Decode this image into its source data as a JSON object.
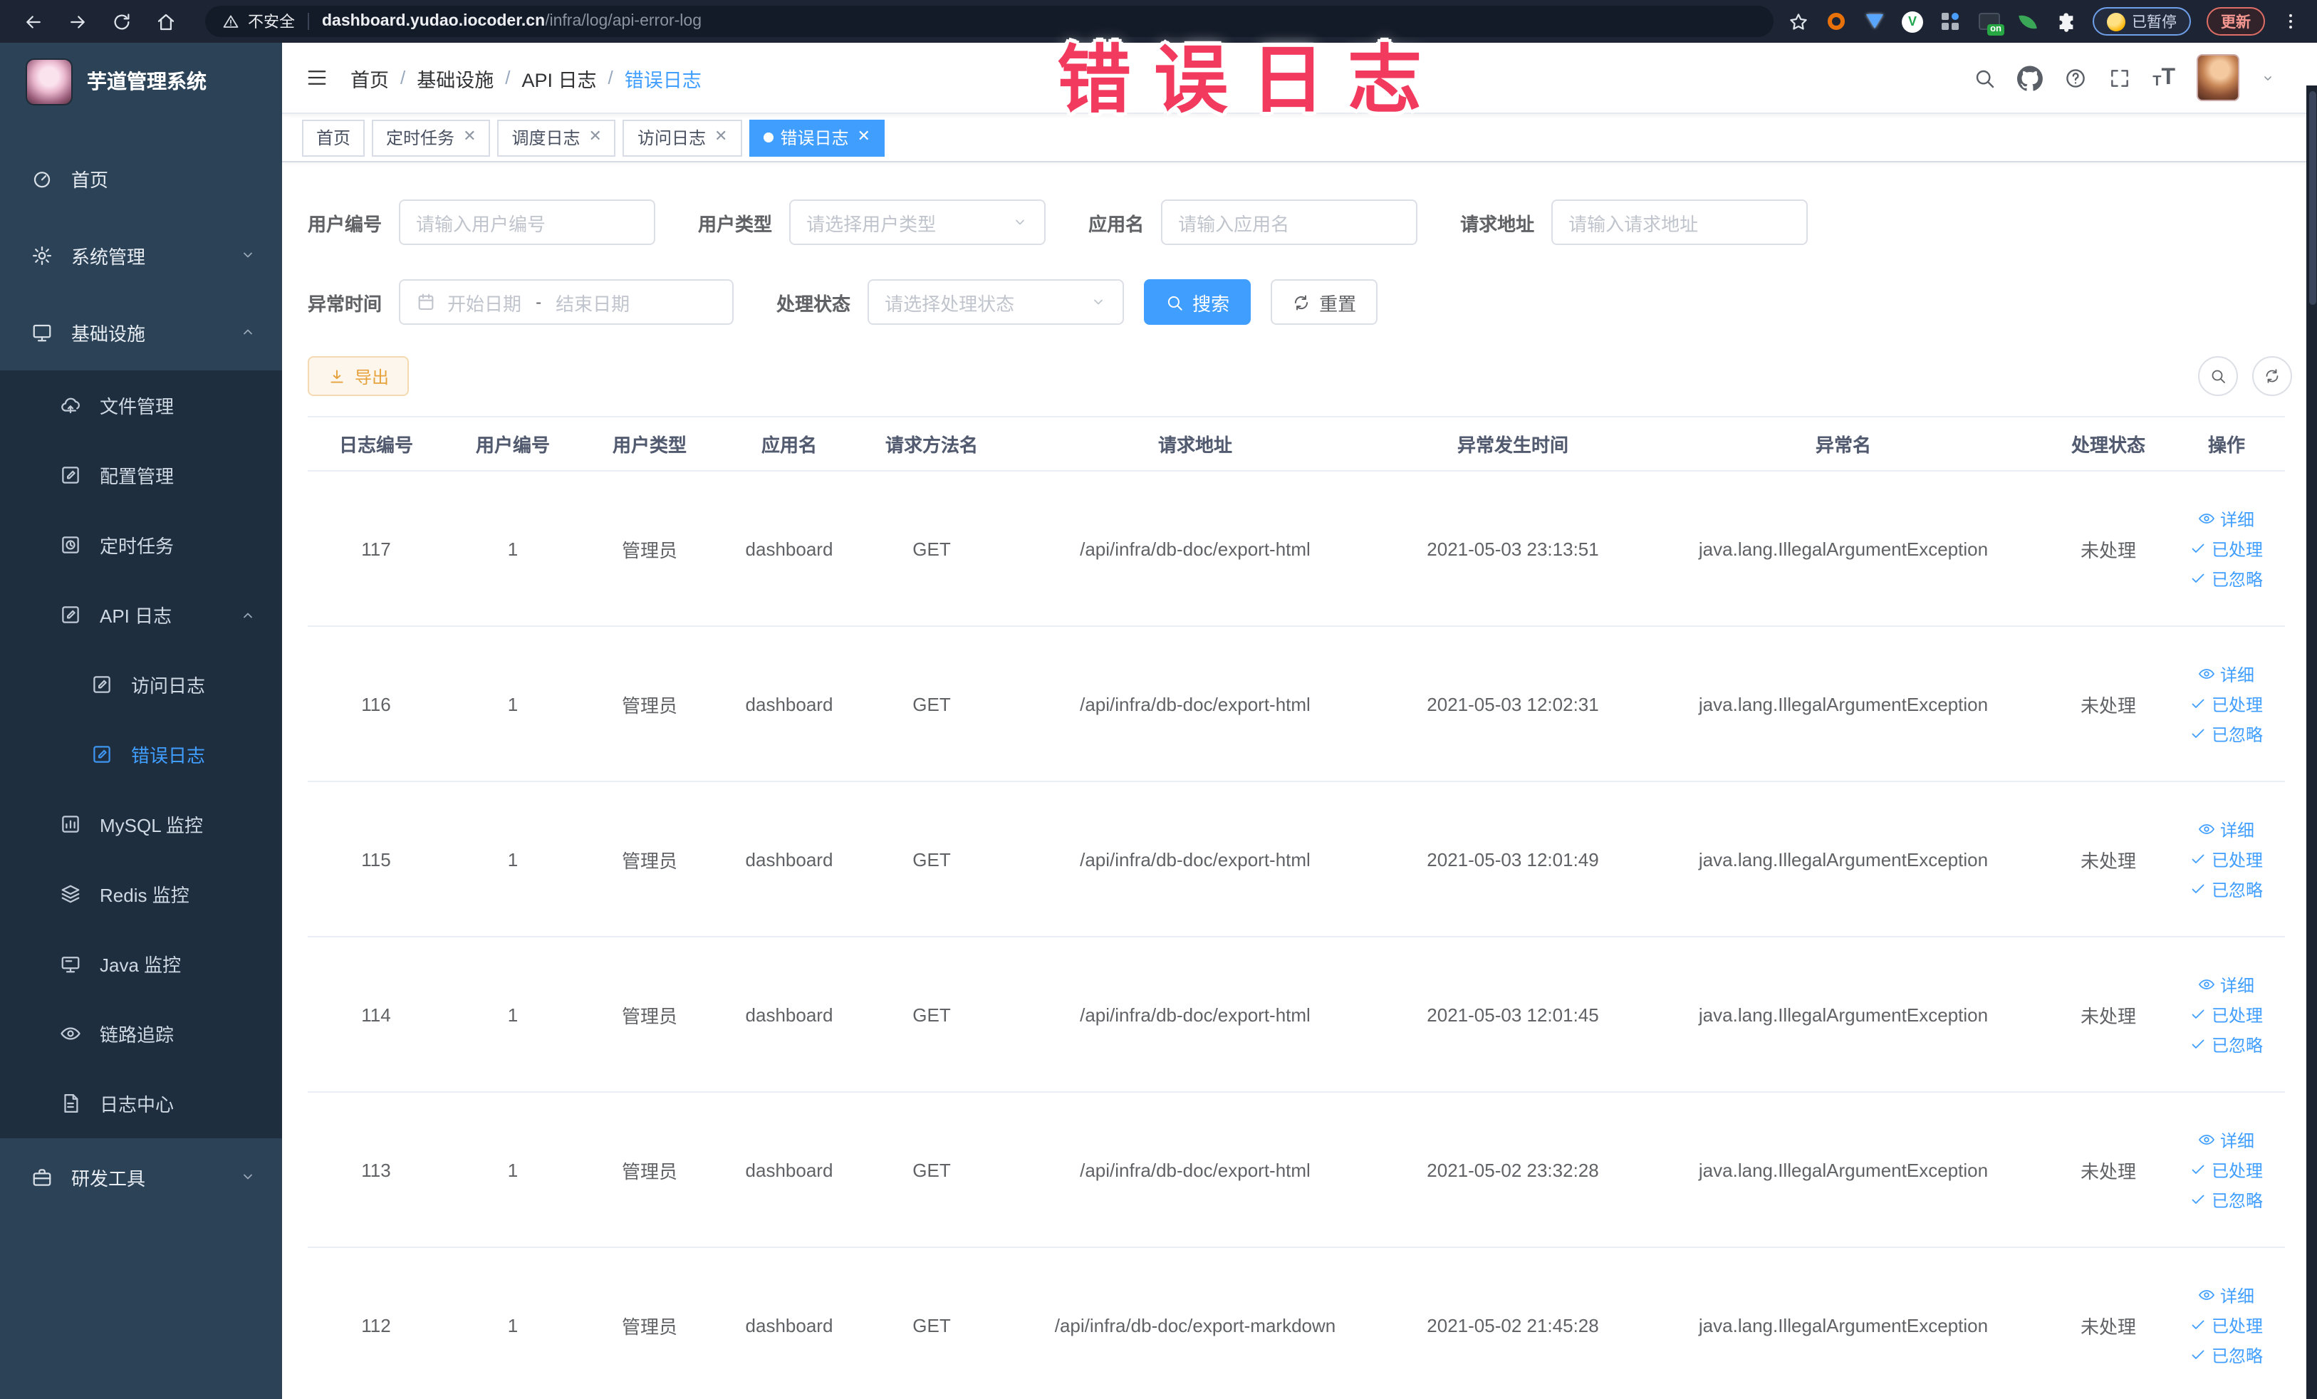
{
  "colors": {
    "accent": "#409eff",
    "warning": "#e6a23c",
    "watermark_red": "#f23a5e",
    "sidebar_bg": "#2c4257",
    "sidebar_section_bg": "#1f2e3f"
  },
  "watermark": {
    "text": "错误日志"
  },
  "browser": {
    "security_label": "不安全",
    "url_host": "dashboard.yudao.iocoder.cn",
    "url_path": "/infra/log/api-error-log",
    "ext_on": "on",
    "paused_label": "已暂停",
    "update_label": "更新"
  },
  "sidebar": {
    "title": "芋道管理系统",
    "items": [
      {
        "key": "home",
        "label": "首页",
        "icon": "dashboard-icon",
        "level": 1
      },
      {
        "key": "system",
        "label": "系统管理",
        "icon": "gear-icon",
        "level": 1,
        "arrow": "down"
      },
      {
        "key": "infra",
        "label": "基础设施",
        "icon": "monitor-icon",
        "level": 1,
        "arrow": "up"
      },
      {
        "key": "file",
        "label": "文件管理",
        "icon": "upload-cloud-icon",
        "level": 2,
        "section": true
      },
      {
        "key": "config",
        "label": "配置管理",
        "icon": "edit-icon",
        "level": 2,
        "section": true
      },
      {
        "key": "job",
        "label": "定时任务",
        "icon": "clock-square-icon",
        "level": 2,
        "section": true
      },
      {
        "key": "api-log",
        "label": "API 日志",
        "icon": "edit-icon",
        "level": 2,
        "arrow": "up",
        "section": true
      },
      {
        "key": "access-log",
        "label": "访问日志",
        "icon": "edit-icon",
        "level": 3,
        "section": true
      },
      {
        "key": "error-log",
        "label": "错误日志",
        "icon": "edit-icon",
        "level": 3,
        "section": true,
        "active": true
      },
      {
        "key": "mysql",
        "label": "MySQL 监控",
        "icon": "chart-icon",
        "level": 2,
        "section": true
      },
      {
        "key": "redis",
        "label": "Redis 监控",
        "icon": "layers-icon",
        "level": 2,
        "section": true
      },
      {
        "key": "java",
        "label": "Java 监控",
        "icon": "screen-icon",
        "level": 2,
        "section": true
      },
      {
        "key": "trace",
        "label": "链路追踪",
        "icon": "eye-icon",
        "level": 2,
        "section": true
      },
      {
        "key": "log-center",
        "label": "日志中心",
        "icon": "doc-icon",
        "level": 2,
        "section": true
      },
      {
        "key": "dev-tools",
        "label": "研发工具",
        "icon": "briefcase-icon",
        "level": 1,
        "arrow": "down"
      }
    ]
  },
  "breadcrumb": [
    "首页",
    "基础设施",
    "API 日志",
    "错误日志"
  ],
  "tabs": [
    {
      "label": "首页",
      "closable": false,
      "active": false
    },
    {
      "label": "定时任务",
      "closable": true,
      "active": false
    },
    {
      "label": "调度日志",
      "closable": true,
      "active": false
    },
    {
      "label": "访问日志",
      "closable": true,
      "active": false
    },
    {
      "label": "错误日志",
      "closable": true,
      "active": true
    }
  ],
  "filters": {
    "user_id": {
      "label": "用户编号",
      "placeholder": "请输入用户编号"
    },
    "user_type": {
      "label": "用户类型",
      "placeholder": "请选择用户类型"
    },
    "app_name": {
      "label": "应用名",
      "placeholder": "请输入应用名"
    },
    "request_url": {
      "label": "请求地址",
      "placeholder": "请输入请求地址"
    },
    "exception_time": {
      "label": "异常时间",
      "start_placeholder": "开始日期",
      "separator": "-",
      "end_placeholder": "结束日期"
    },
    "process_status": {
      "label": "处理状态",
      "placeholder": "请选择处理状态"
    },
    "search_label": "搜索",
    "reset_label": "重置"
  },
  "toolbar": {
    "export_label": "导出"
  },
  "table": {
    "columns": [
      "日志编号",
      "用户编号",
      "用户类型",
      "应用名",
      "请求方法名",
      "请求地址",
      "异常发生时间",
      "异常名",
      "处理状态",
      "操作"
    ],
    "row_actions": [
      {
        "icon": "eye-icon",
        "label": "详细"
      },
      {
        "icon": "check-icon",
        "label": "已处理"
      },
      {
        "icon": "check-icon",
        "label": "已忽略"
      }
    ],
    "rows": [
      {
        "id": "117",
        "user_id": "1",
        "user_type": "管理员",
        "app": "dashboard",
        "method": "GET",
        "url": "/api/infra/db-doc/export-html",
        "time": "2021-05-03 23:13:51",
        "exception": "java.lang.IllegalArgumentException",
        "status": "未处理"
      },
      {
        "id": "116",
        "user_id": "1",
        "user_type": "管理员",
        "app": "dashboard",
        "method": "GET",
        "url": "/api/infra/db-doc/export-html",
        "time": "2021-05-03 12:02:31",
        "exception": "java.lang.IllegalArgumentException",
        "status": "未处理"
      },
      {
        "id": "115",
        "user_id": "1",
        "user_type": "管理员",
        "app": "dashboard",
        "method": "GET",
        "url": "/api/infra/db-doc/export-html",
        "time": "2021-05-03 12:01:49",
        "exception": "java.lang.IllegalArgumentException",
        "status": "未处理"
      },
      {
        "id": "114",
        "user_id": "1",
        "user_type": "管理员",
        "app": "dashboard",
        "method": "GET",
        "url": "/api/infra/db-doc/export-html",
        "time": "2021-05-03 12:01:45",
        "exception": "java.lang.IllegalArgumentException",
        "status": "未处理"
      },
      {
        "id": "113",
        "user_id": "1",
        "user_type": "管理员",
        "app": "dashboard",
        "method": "GET",
        "url": "/api/infra/db-doc/export-html",
        "time": "2021-05-02 23:32:28",
        "exception": "java.lang.IllegalArgumentException",
        "status": "未处理"
      },
      {
        "id": "112",
        "user_id": "1",
        "user_type": "管理员",
        "app": "dashboard",
        "method": "GET",
        "url": "/api/infra/db-doc/export-markdown",
        "time": "2021-05-02 21:45:28",
        "exception": "java.lang.IllegalArgumentException",
        "status": "未处理"
      }
    ]
  }
}
